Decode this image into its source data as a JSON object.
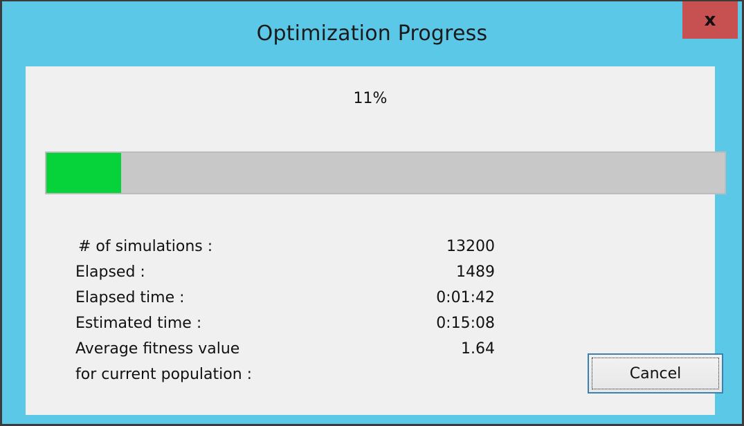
{
  "window": {
    "title": "Optimization Progress",
    "close_icon": "close-icon",
    "close_glyph": "x"
  },
  "progress": {
    "percent_text": "11%",
    "value": 0.11,
    "fill_color": "#06d23a",
    "track_color": "#c8c8c8"
  },
  "stats": [
    {
      "label": "# of simulations :",
      "value": "13200"
    },
    {
      "label": "Elapsed :",
      "value": "1489"
    },
    {
      "label": "Elapsed time :",
      "value": "0:01:42"
    },
    {
      "label": "Estimated time :",
      "value": "0:15:08"
    },
    {
      "label": "Average fitness value",
      "value": "1.64"
    },
    {
      "label": "for current population :",
      "value": ""
    }
  ],
  "buttons": {
    "cancel_label": "Cancel"
  },
  "colors": {
    "frame": "#5cc8e8",
    "close_button": "#c75050",
    "client_bg": "#f0f0f0",
    "button_border": "#3c7fb1"
  }
}
